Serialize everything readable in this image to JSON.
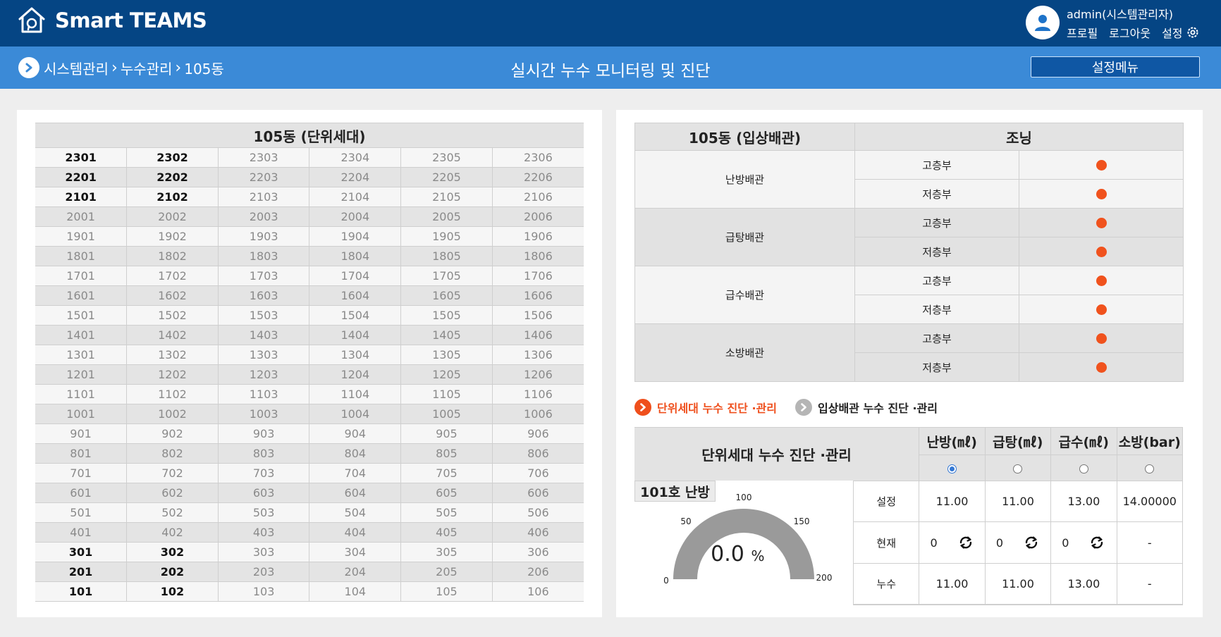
{
  "header": {
    "app_name": "Smart TEAMS",
    "user_name": "admin(시스템관리자)",
    "links": [
      "프로필",
      "로그아웃"
    ],
    "settings_label": "설정"
  },
  "subheader": {
    "breadcrumb": [
      "시스템관리",
      "누수관리",
      "105동"
    ],
    "page_title": "실시간 누수 모니터링 및 진단",
    "menu_button": "설정메뉴"
  },
  "unit_grid": {
    "title": "105동 (단위세대)",
    "rows": [
      [
        "2301",
        "2302",
        "2303",
        "2304",
        "2305",
        "2306"
      ],
      [
        "2201",
        "2202",
        "2203",
        "2204",
        "2205",
        "2206"
      ],
      [
        "2101",
        "2102",
        "2103",
        "2104",
        "2105",
        "2106"
      ],
      [
        "2001",
        "2002",
        "2003",
        "2004",
        "2005",
        "2006"
      ],
      [
        "1901",
        "1902",
        "1903",
        "1904",
        "1905",
        "1906"
      ],
      [
        "1801",
        "1802",
        "1803",
        "1804",
        "1805",
        "1806"
      ],
      [
        "1701",
        "1702",
        "1703",
        "1704",
        "1705",
        "1706"
      ],
      [
        "1601",
        "1602",
        "1603",
        "1604",
        "1605",
        "1606"
      ],
      [
        "1501",
        "1502",
        "1503",
        "1504",
        "1505",
        "1506"
      ],
      [
        "1401",
        "1402",
        "1403",
        "1404",
        "1405",
        "1406"
      ],
      [
        "1301",
        "1302",
        "1303",
        "1304",
        "1305",
        "1306"
      ],
      [
        "1201",
        "1202",
        "1203",
        "1204",
        "1205",
        "1206"
      ],
      [
        "1101",
        "1102",
        "1103",
        "1104",
        "1105",
        "1106"
      ],
      [
        "1001",
        "1002",
        "1003",
        "1004",
        "1005",
        "1006"
      ],
      [
        "901",
        "902",
        "903",
        "904",
        "905",
        "906"
      ],
      [
        "801",
        "802",
        "803",
        "804",
        "805",
        "806"
      ],
      [
        "701",
        "702",
        "703",
        "704",
        "705",
        "706"
      ],
      [
        "601",
        "602",
        "603",
        "604",
        "605",
        "606"
      ],
      [
        "501",
        "502",
        "503",
        "504",
        "505",
        "506"
      ],
      [
        "401",
        "402",
        "403",
        "404",
        "405",
        "406"
      ],
      [
        "301",
        "302",
        "303",
        "304",
        "305",
        "306"
      ],
      [
        "201",
        "202",
        "203",
        "204",
        "205",
        "206"
      ],
      [
        "101",
        "102",
        "103",
        "104",
        "105",
        "106"
      ]
    ],
    "active_units": [
      "2301",
      "2302",
      "2201",
      "2202",
      "2101",
      "2102",
      "301",
      "302",
      "201",
      "202",
      "101",
      "102"
    ]
  },
  "riser": {
    "header_left": "105동 (입상배관)",
    "header_right": "조닝",
    "groups": [
      {
        "name": "난방배관",
        "zones": [
          "고층부",
          "저층부"
        ]
      },
      {
        "name": "급탕배관",
        "zones": [
          "고층부",
          "저층부"
        ]
      },
      {
        "name": "급수배관",
        "zones": [
          "고층부",
          "저층부"
        ]
      },
      {
        "name": "소방배관",
        "zones": [
          "고층부",
          "저층부"
        ]
      }
    ],
    "status_color": "#f0521d"
  },
  "mode_tabs": [
    {
      "label": "단위세대 누수 진단 ·관리",
      "active": true
    },
    {
      "label": "입상배관 누수 진단 ·관리",
      "active": false
    }
  ],
  "diagnosis": {
    "title": "단위세대 누수 진단 ·관리",
    "columns": [
      "난방(㎖)",
      "급탕(㎖)",
      "급수(㎖)",
      "소방(bar)"
    ],
    "selected_index": 0,
    "gauge": {
      "label": "101호 난방",
      "value": "0.0",
      "unit": "%",
      "value_num": 0,
      "min": 0,
      "max": 200,
      "ticks": [
        "0",
        "50",
        "100",
        "150",
        "200"
      ]
    },
    "rows": [
      {
        "label": "설정",
        "values": [
          "11.00",
          "11.00",
          "13.00",
          "14.00000"
        ]
      },
      {
        "label": "현재",
        "values": [
          "0",
          "0",
          "0",
          "-"
        ]
      },
      {
        "label": "누수",
        "values": [
          "11.00",
          "11.00",
          "13.00",
          "-"
        ]
      }
    ],
    "refresh_icon": "refresh-icon"
  }
}
